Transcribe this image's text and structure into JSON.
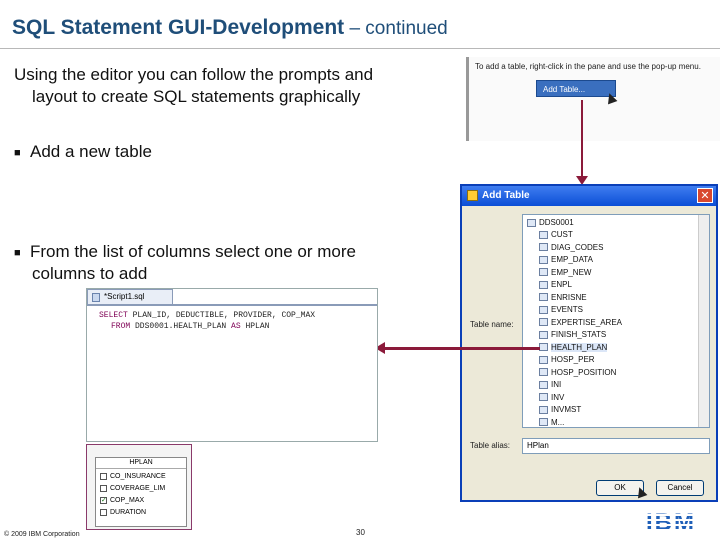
{
  "slide": {
    "title": "SQL Statement GUI-Development",
    "title_suffix": " – continued",
    "intro_line1": "Using the editor you can follow the prompts and",
    "intro_line2": "layout to create SQL statements graphically",
    "bullet1": "Add a new table",
    "bullet2_line1": "From the list of columns select one or more",
    "bullet2_line2": "columns to add"
  },
  "snippet": {
    "hint": "To add a table, right-click in the pane and use the pop-up menu.",
    "menu_item": "Add Table..."
  },
  "dialog": {
    "title": "Add Table",
    "table_name_label": "Table name:",
    "table_alias_label": "Table alias:",
    "alias_value": "HPlan",
    "root": "DDS0001",
    "tables": [
      "CUST",
      "DIAG_CODES",
      "EMP_DATA",
      "EMP_NEW",
      "ENPL",
      "ENRISNE",
      "EVENTS",
      "EXPERTISE_AREA",
      "FINISH_STATS",
      "HEALTH_PLAN",
      "HOSP_PER",
      "HOSP_POSITION",
      "INI",
      "INV",
      "INVMST",
      "M..."
    ],
    "selected_table": "HEALTH_PLAN",
    "ok_label": "OK",
    "cancel_label": "Cancel",
    "colors": {
      "titlebar": "#0b4ed6",
      "selection": "#dbe6f7"
    }
  },
  "editor": {
    "tab_label": "*Script1.sql",
    "line1_kw": "SELECT",
    "line1_rest": " PLAN_ID, DEDUCTIBLE, PROVIDER, COP_MAX",
    "line2_kw": "FROM",
    "line2_mid": " DDS0001.HEALTH_PLAN ",
    "line2_kw2": "AS",
    "line2_rest": " HPLAN"
  },
  "diagram": {
    "table_name": "HPLAN",
    "columns": [
      {
        "name": "CO_INSURANCE",
        "checked": false
      },
      {
        "name": "COVERAGE_LIM",
        "checked": false
      },
      {
        "name": "COP_MAX",
        "checked": true
      },
      {
        "name": "DURATION",
        "checked": false
      }
    ]
  },
  "footer": {
    "copyright": "© 2009 IBM Corporation",
    "page": "30",
    "logo": "IBM"
  }
}
